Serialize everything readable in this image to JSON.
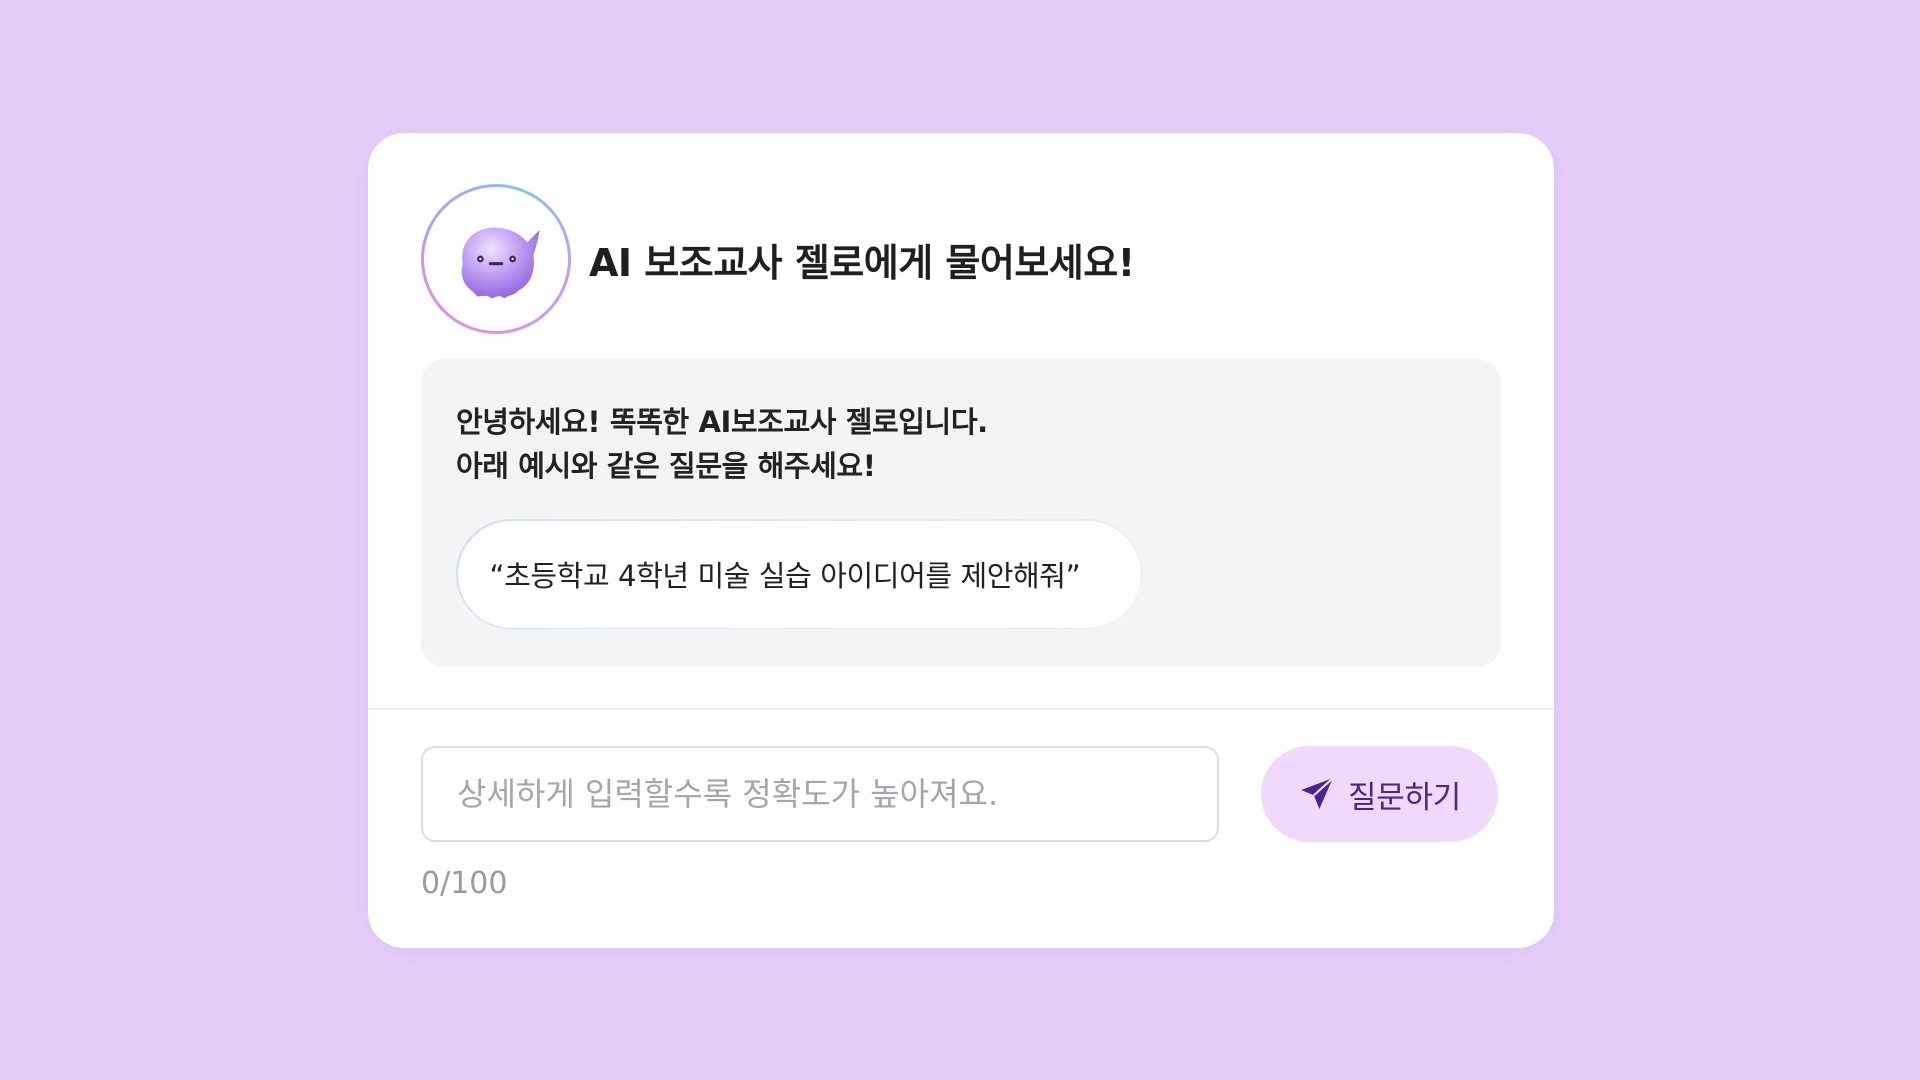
{
  "header": {
    "title": "AI 보조교사 젤로에게 물어보세요!",
    "avatar_icon": "jello-mascot-icon"
  },
  "intro": {
    "line1": "안녕하세요! 똑똑한 AI보조교사 젤로입니다.",
    "line2": "아래 예시와 같은 질문을 해주세요!",
    "example": "“초등학교 4학년 미술 실습 아이디어를 제안해줘”"
  },
  "input": {
    "value": "",
    "placeholder": "상세하게 입력할수록 정확도가 높아져요.",
    "counter": "0/100"
  },
  "ask_button": {
    "label": "질문하기",
    "icon": "send-icon"
  },
  "colors": {
    "background": "#e6cff9",
    "card": "#ffffff",
    "intro_box": "#f4f4f5",
    "button_bg": "#f1d9fb",
    "accent": "#4b2493",
    "mascot": "#b58cf0"
  }
}
